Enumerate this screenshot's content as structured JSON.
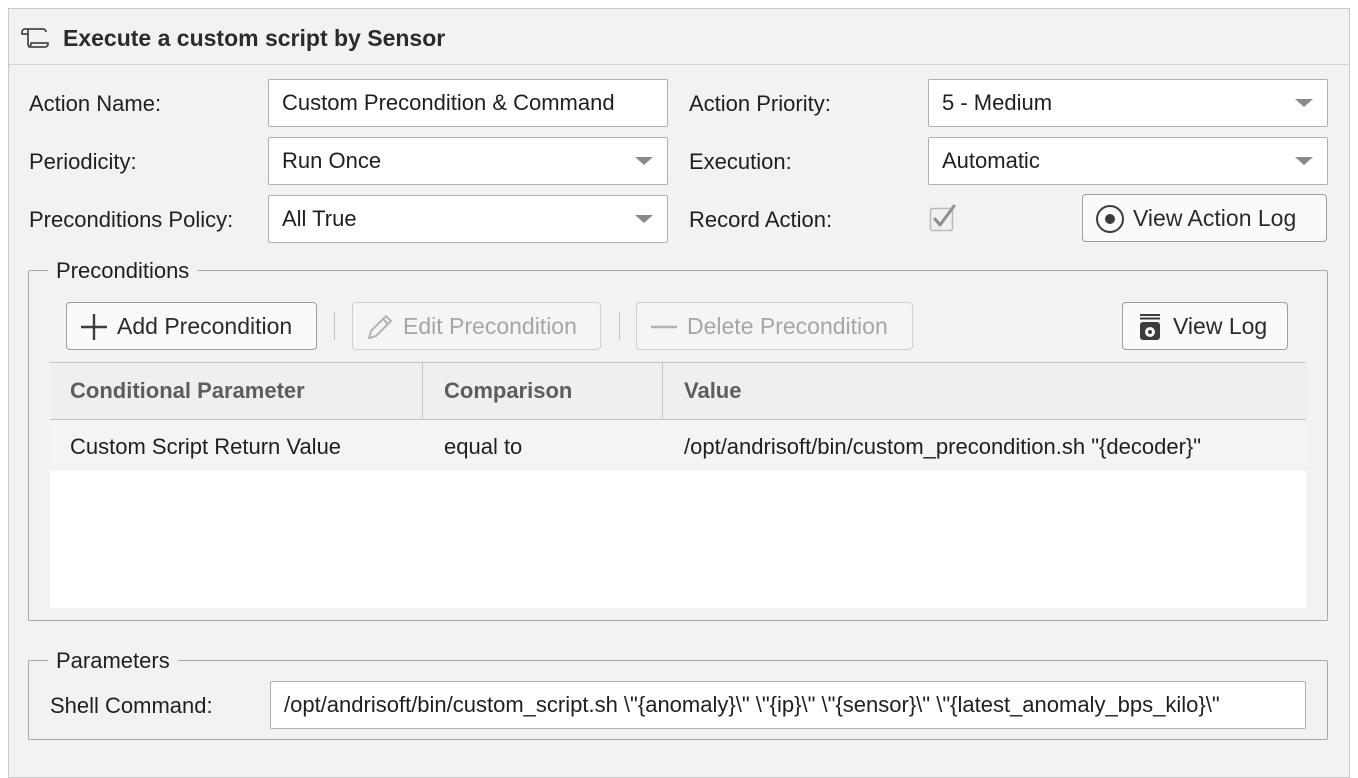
{
  "header": {
    "title": "Execute a custom script by Sensor",
    "icon": "script-scroll-icon"
  },
  "form": {
    "action_name": {
      "label": "Action Name:",
      "value": "Custom Precondition & Command"
    },
    "action_priority": {
      "label": "Action Priority:",
      "value": "5 - Medium"
    },
    "periodicity": {
      "label": "Periodicity:",
      "value": "Run Once"
    },
    "execution": {
      "label": "Execution:",
      "value": "Automatic"
    },
    "preconditions_policy": {
      "label": "Preconditions Policy:",
      "value": "All True"
    },
    "record_action": {
      "label": "Record Action:",
      "checked": true
    },
    "view_action_log_label": "View Action Log"
  },
  "preconditions": {
    "legend": "Preconditions",
    "toolbar": {
      "add_label": "Add Precondition",
      "edit_label": "Edit Precondition",
      "delete_label": "Delete Precondition",
      "view_log_label": "View Log"
    },
    "columns": [
      "Conditional Parameter",
      "Comparison",
      "Value"
    ],
    "rows": [
      [
        "Custom Script Return Value",
        "equal to",
        "/opt/andrisoft/bin/custom_precondition.sh \"{decoder}\""
      ]
    ]
  },
  "parameters": {
    "legend": "Parameters",
    "shell_command": {
      "label": "Shell Command:",
      "value": "/opt/andrisoft/bin/custom_script.sh \\\"{anomaly}\\\" \\\"{ip}\\\" \\\"{sensor}\\\" \\\"{latest_anomaly_bps_kilo}\\\""
    }
  },
  "colors": {
    "background": "#f2f2f2",
    "border": "#c9c9c9",
    "disabled_text": "#a6a6a6",
    "header_text": "#5d5d5d"
  }
}
